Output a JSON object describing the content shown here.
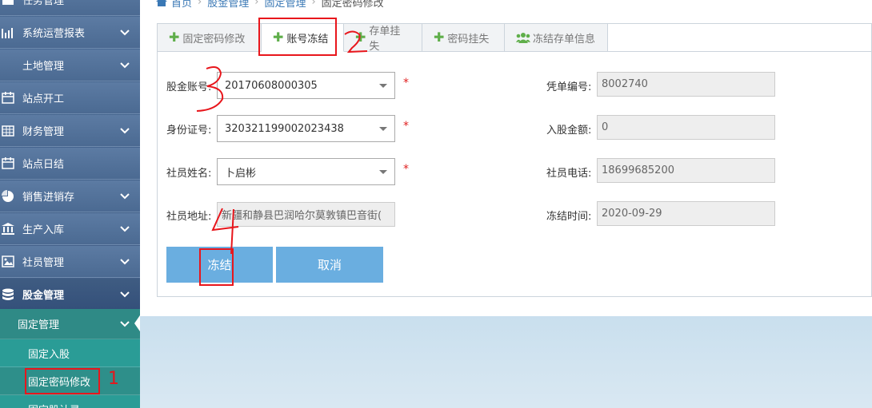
{
  "breadcrumb": {
    "home": "首页",
    "items": [
      "股金管理",
      "固定管理"
    ],
    "current": "固定密码修改"
  },
  "sidebar": {
    "top_cut": "任务管理",
    "items": [
      {
        "label": "系统运营报表",
        "icon": "bar-chart-icon"
      },
      {
        "label": "土地管理",
        "icon": ""
      },
      {
        "label": "站点开工",
        "icon": "calendar-icon"
      },
      {
        "label": "财务管理",
        "icon": "table-icon"
      },
      {
        "label": "站点日结",
        "icon": "calendar-icon"
      },
      {
        "label": "销售进销存",
        "icon": "pie-chart-icon"
      },
      {
        "label": "生产入库",
        "icon": "bank-icon"
      },
      {
        "label": "社员管理",
        "icon": "image-icon"
      },
      {
        "label": "股金管理",
        "icon": "database-icon"
      }
    ],
    "sub": {
      "group": "固定管理",
      "items": [
        "固定入股",
        "固定密码修改",
        "固定股认录"
      ]
    }
  },
  "tabs": [
    {
      "label": "固定密码修改",
      "icon": "plus-icon"
    },
    {
      "label": "账号冻结",
      "icon": "plus-icon"
    },
    {
      "label": "存单挂失",
      "icon": "plus-icon"
    },
    {
      "label": "密码挂失",
      "icon": "plus-icon"
    },
    {
      "label": "冻结存单信息",
      "icon": "users-icon"
    }
  ],
  "form": {
    "account_label": "股金账号:",
    "account_value": "20170608000305",
    "id_label": "身份证号:",
    "id_value": "320321199002023438",
    "name_label": "社员姓名:",
    "name_value": "卜启彬",
    "address_label": "社员地址:",
    "address_value": "新疆和静县巴润哈尔莫敦镇巴音街(",
    "voucher_label": "凭单编号:",
    "voucher_value": "8002740",
    "amount_label": "入股金额:",
    "amount_value": "0",
    "phone_label": "社员电话:",
    "phone_value": "18699685200",
    "freeze_time_label": "冻结时间:",
    "freeze_time_value": "2020-09-29",
    "required_mark": "*"
  },
  "buttons": {
    "freeze": "冻结",
    "cancel": "取消"
  },
  "annotations": {
    "mark1": "1",
    "color": "#e8161c"
  },
  "colors": {
    "button": "#6aaee0",
    "sidebar": "#4b6a92",
    "sub_menu": "#2a9c96",
    "tab_plus": "#5fae4a"
  }
}
